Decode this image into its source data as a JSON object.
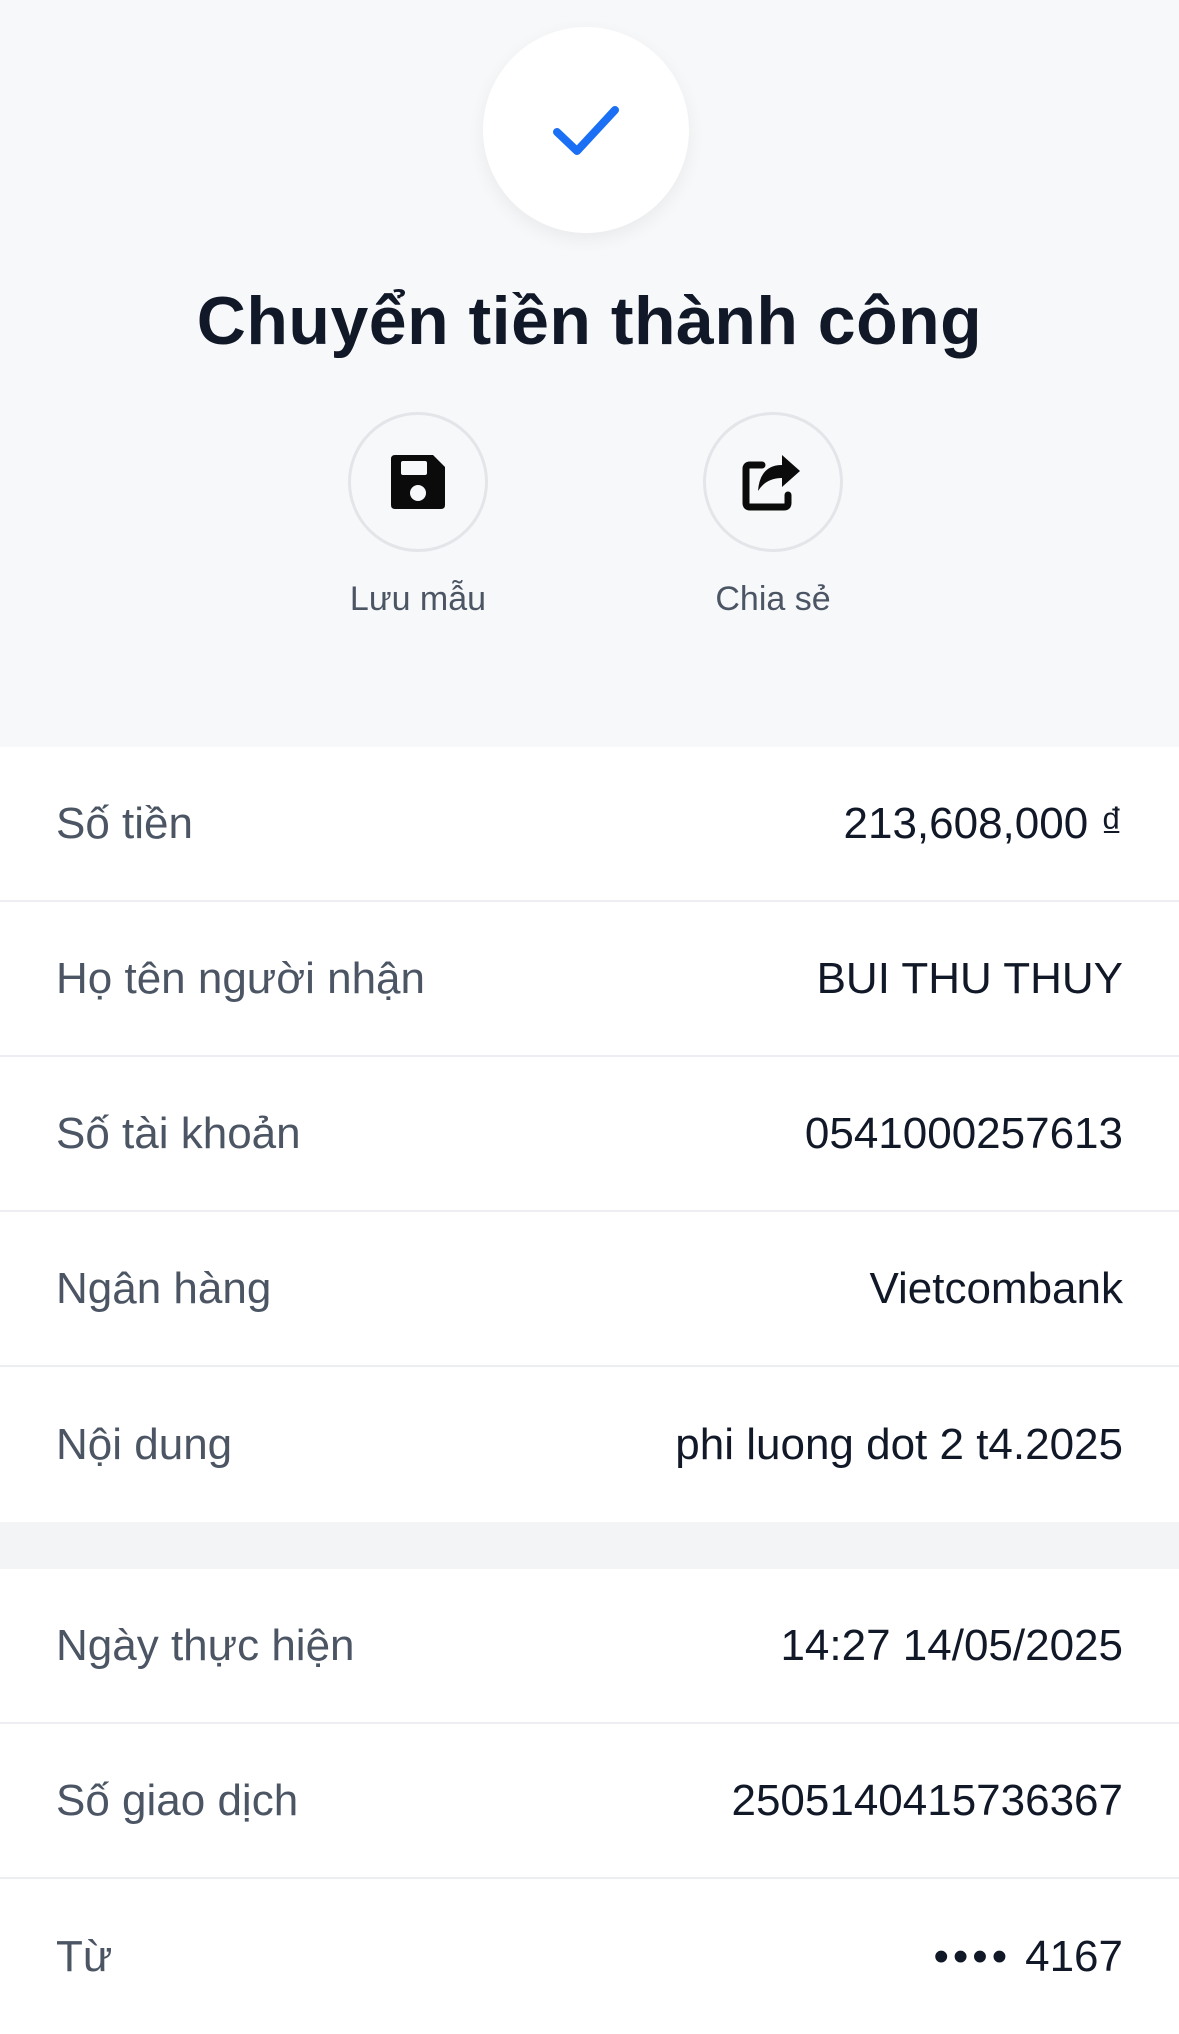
{
  "header": {
    "title": "Chuyển tiền thành công",
    "check_icon": "check-icon",
    "accent_color": "#1a6ff5",
    "actions": [
      {
        "label": "Lưu mẫu",
        "icon": "save-icon"
      },
      {
        "label": "Chia sẻ",
        "icon": "share-icon"
      }
    ]
  },
  "details": [
    {
      "label": "Số tiền",
      "value": "213,608,000 ₫"
    },
    {
      "label": "Họ tên người nhận",
      "value": "BUI THU THUY"
    },
    {
      "label": "Số tài khoản",
      "value": "0541000257613"
    },
    {
      "label": "Ngân hàng",
      "value": "Vietcombank"
    },
    {
      "label": "Nội dung",
      "value": "phi luong dot 2 t4.2025"
    }
  ],
  "transaction": [
    {
      "label": "Ngày thực hiện",
      "value": "14:27 14/05/2025"
    },
    {
      "label": "Số giao dịch",
      "value": "2505140415736367"
    },
    {
      "label": "Từ",
      "mask": "••••",
      "value": "4167"
    }
  ]
}
